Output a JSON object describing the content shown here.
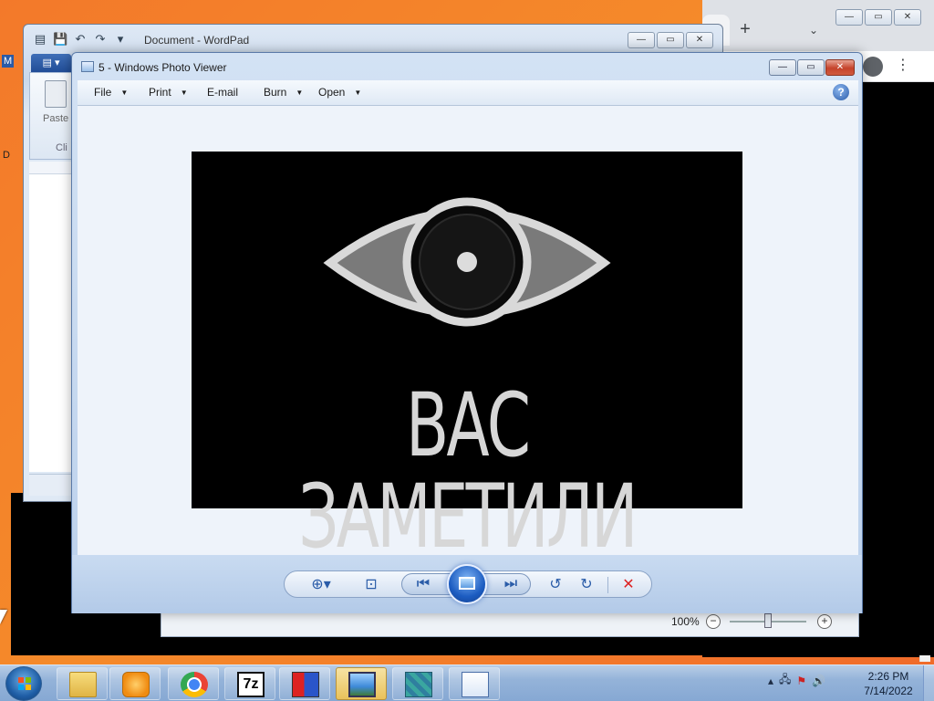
{
  "wordpad": {
    "title": "Document - WordPad",
    "ribbon_tab": "▤ ▾",
    "paste_label": "Paste",
    "clipboard_group": "Cli"
  },
  "left_strip": {
    "label_m": "M",
    "label_d": "D"
  },
  "browser": {
    "newtab": "+",
    "tabsearch": "⌄",
    "menu": "⋮"
  },
  "photo_viewer": {
    "title": "5 - Windows Photo Viewer",
    "menu": [
      "File",
      "Print",
      "E-mail",
      "Burn",
      "Open"
    ],
    "help": "?",
    "image_caption": "ВАС ЗАМЕТИЛИ",
    "window_controls": {
      "minimize": "—",
      "maximize": "▭",
      "close": "✕"
    }
  },
  "zoom": {
    "readout": "100%",
    "minus": "−",
    "plus": "+"
  },
  "taskbar": {
    "tray_arrow": "▴",
    "clock_time": "2:26 PM",
    "clock_date": "7/14/2022",
    "apps": [
      "explorer-icon",
      "media-player-icon",
      "chrome-icon",
      "7zip-icon",
      "setup-icon",
      "photo-viewer-icon",
      "network-tool-icon",
      "wordpad-icon"
    ],
    "sevenzip_label": "7z"
  }
}
